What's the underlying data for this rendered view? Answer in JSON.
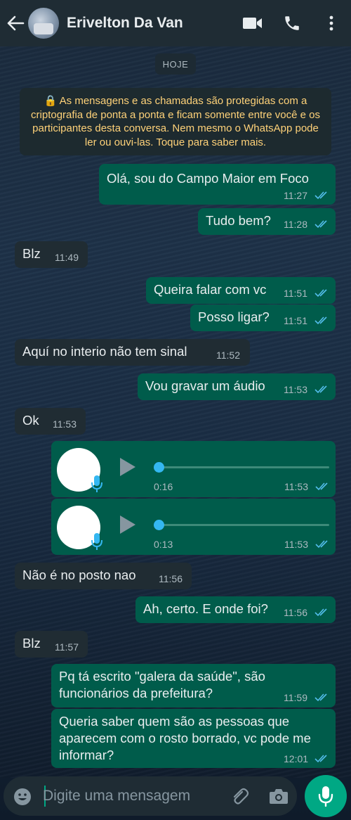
{
  "header": {
    "contact_name": "Erivelton Da Van",
    "icons": [
      "back-arrow-icon",
      "video-call-icon",
      "voice-call-icon",
      "more-options-icon"
    ]
  },
  "chat": {
    "date_chip": "HOJE",
    "encryption_notice": "As mensagens e as chamadas são protegidas com a criptografia de ponta a ponta e ficam somente entre você e os participantes desta conversa. Nem mesmo o WhatsApp pode ler ou ouvi-las. Toque para saber mais.",
    "messages": [
      {
        "dir": "out",
        "text": "Olá, sou do Campo Maior em Foco",
        "time": "11:27",
        "status": "read"
      },
      {
        "dir": "out",
        "text": "Tudo bem?",
        "time": "11:28",
        "status": "read"
      },
      {
        "dir": "in",
        "text": "Blz",
        "time": "11:49"
      },
      {
        "dir": "out",
        "text": "Queira falar com vc",
        "time": "11:51",
        "status": "read"
      },
      {
        "dir": "out",
        "text": "Posso ligar?",
        "time": "11:51",
        "status": "read"
      },
      {
        "dir": "in",
        "text": "Aquí no interio não tem sinal",
        "time": "11:52"
      },
      {
        "dir": "out",
        "text": "Vou gravar um áudio",
        "time": "11:53",
        "status": "read"
      },
      {
        "dir": "in",
        "text": "Ok",
        "time": "11:53"
      },
      {
        "dir": "out",
        "type": "audio",
        "duration": "0:16",
        "time": "11:53",
        "status": "read",
        "progress": 0
      },
      {
        "dir": "out",
        "type": "audio",
        "duration": "0:13",
        "time": "11:53",
        "status": "read",
        "progress": 0
      },
      {
        "dir": "in",
        "text": "Não é no posto nao",
        "time": "11:56"
      },
      {
        "dir": "out",
        "text": "Ah, certo. E onde foi?",
        "time": "11:56",
        "status": "read"
      },
      {
        "dir": "in",
        "text": "Blz",
        "time": "11:57"
      },
      {
        "dir": "out",
        "text": "Pq tá escrito \"galera da saúde\", são funcionários da prefeitura?",
        "time": "11:59",
        "status": "read"
      },
      {
        "dir": "out",
        "text": "Queria saber quem são as pessoas que aparecem com o rosto borrado, vc pode me informar?",
        "time": "12:01",
        "status": "read"
      }
    ]
  },
  "composer": {
    "placeholder": "Digite uma mensagem",
    "icons": [
      "emoji-icon",
      "attach-icon",
      "camera-icon",
      "microphone-icon"
    ]
  },
  "colors": {
    "outgoing_bubble": "#005c4b",
    "incoming_bubble": "#202c33",
    "read_ticks": "#53bdeb",
    "accent": "#00a884",
    "header": "#1f2c34"
  }
}
